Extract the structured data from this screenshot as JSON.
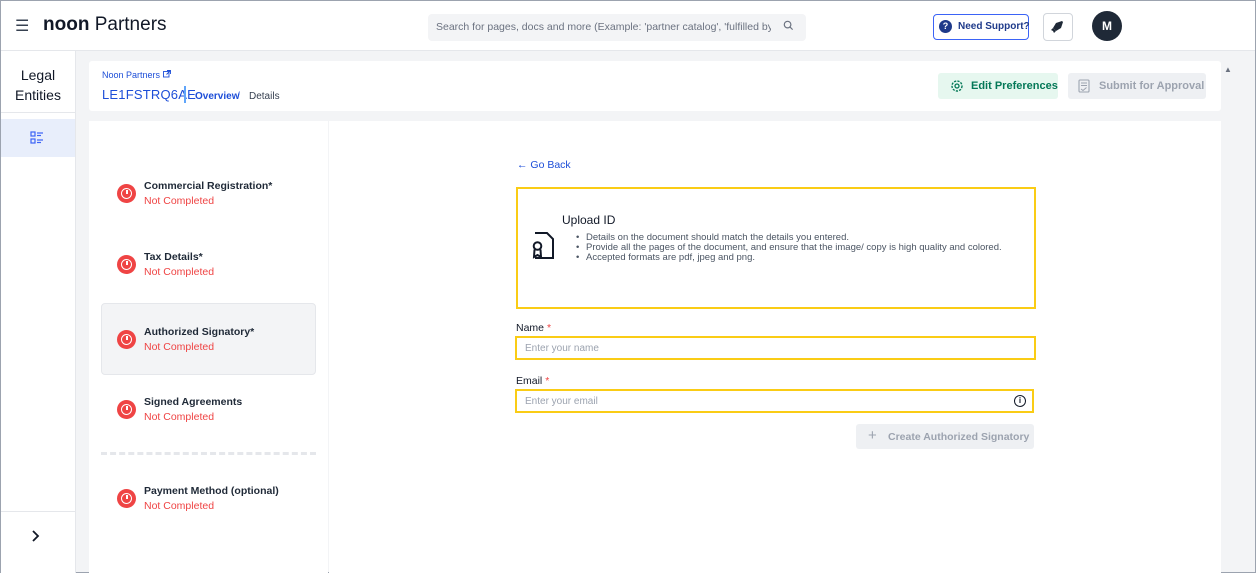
{
  "topbar": {
    "menu_icon": "hamburger-icon",
    "brand_bold": "noon",
    "brand_rest": " Partners",
    "search_placeholder": "Search for pages, docs and more (Example: 'partner catalog', 'fulfilled by noon')",
    "support_label": "Need Support?",
    "avatar_initial": "M"
  },
  "rail": {
    "title_line1": "Legal",
    "title_line2": "Entities",
    "expand_icon": "chevron-right-icon"
  },
  "header": {
    "crumb_root": "Noon Partners",
    "entity_id": "LE1FSTRQ6AE",
    "crumb_overview": "Overview",
    "crumb_sep": "/",
    "crumb_current": "Details",
    "edit_preferences_label": "Edit Preferences",
    "submit_label": "Submit for Approval"
  },
  "steps": [
    {
      "title": "Commercial Registration*",
      "status": "Not Completed"
    },
    {
      "title": "Tax Details*",
      "status": "Not Completed"
    },
    {
      "title": "Authorized Signatory*",
      "status": "Not Completed"
    },
    {
      "title": "Signed Agreements",
      "status": "Not Completed"
    },
    {
      "title": "Payment Method (optional)",
      "status": "Not Completed"
    }
  ],
  "main": {
    "go_back_label": "← Go Back",
    "upload_title": "Upload ID",
    "upload_bullets": [
      "Details on the document should match the details you entered.",
      "Provide all the pages of the document, and ensure that the image/ copy is high quality and colored.",
      "Accepted formats are pdf, jpeg and png."
    ],
    "name_label": "Name",
    "name_placeholder": "Enter your name",
    "email_label": "Email",
    "email_placeholder": "Enter your email",
    "required_mark": "*",
    "info_glyph": "i",
    "create_label": "Create Authorized Signatory"
  },
  "colors": {
    "accent_blue": "#1d4ed8",
    "error_red": "#ef4444",
    "highlight_yellow": "#facc15",
    "success_green": "#047857"
  }
}
